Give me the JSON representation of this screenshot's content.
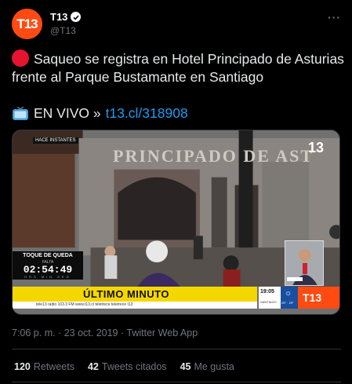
{
  "author": {
    "avatar_text": "T13",
    "display_name": "T13",
    "handle": "@T13",
    "verified": true,
    "more_menu": "···"
  },
  "tweet": {
    "line1_icon": "red-circle-icon",
    "line1": "Saqueo se registra en Hotel Principado de Asturias frente al Parque Bustamante en Santiago",
    "line2_icon": "television-icon",
    "line2_text": "EN VIVO »",
    "link": "t13.cl/318908"
  },
  "media": {
    "live_tag": "HACE INSTANTES",
    "hotel_sign": "PRINCIPADO DE AST",
    "channel_bug": "13",
    "curfew": {
      "title": "TOQUE DE QUEDA",
      "subtitle": "FALTA",
      "time": "02:54:49",
      "units": "HRS MIN SEG"
    },
    "ticker": "ÚLTIMO MINUTO",
    "ticker_sub": "tele13 radio 103.3 FM   www.t13.cl   teletrece   teletrece   t13",
    "clock": "19:05",
    "clock_location": "SANTIAGO",
    "weather_icon": "sun-icon",
    "temperature": "25° · 29°",
    "logo_text": "T13"
  },
  "timestamp": "7:06 p. m. · 23 oct. 2019 · Twitter Web App",
  "stats": [
    {
      "count": "120",
      "label": "Retweets"
    },
    {
      "count": "42",
      "label": "Tweets citados"
    },
    {
      "count": "45",
      "label": "Me gusta"
    }
  ],
  "colors": {
    "accent": "#1d9bf0",
    "brand": "#ff4b12",
    "ticker": "#f5d700",
    "background": "#000000"
  }
}
